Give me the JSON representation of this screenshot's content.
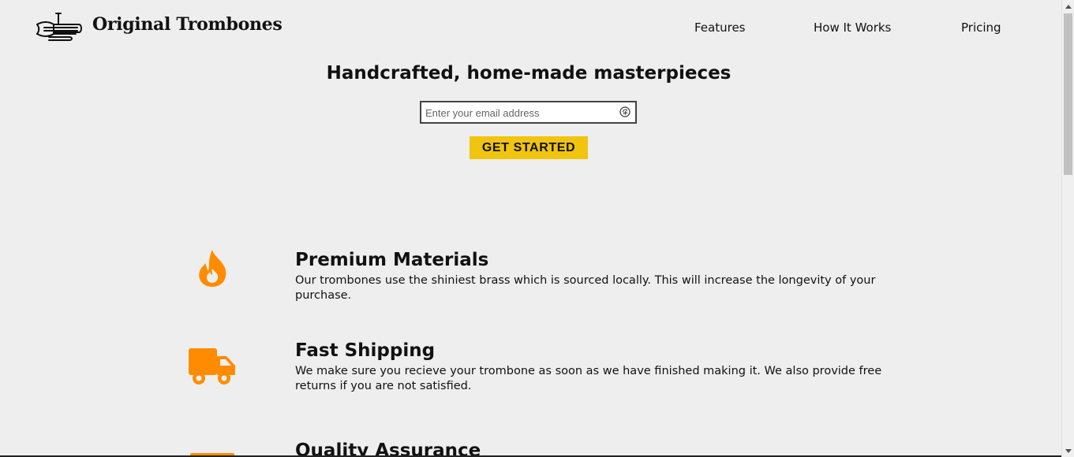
{
  "header": {
    "brand": "Original Trombones",
    "logo_icon": "trombone-icon",
    "nav": [
      {
        "label": "Features"
      },
      {
        "label": "How It Works"
      },
      {
        "label": "Pricing"
      }
    ]
  },
  "hero": {
    "title": "Handcrafted, home-made masterpieces",
    "email_placeholder": "Enter your email address",
    "email_value": "",
    "cta_label": "GET STARTED"
  },
  "features": [
    {
      "icon": "fire-icon",
      "title": "Premium Materials",
      "text": "Our trombones use the shiniest brass which is sourced locally. This will increase the longevity of your purchase."
    },
    {
      "icon": "truck-icon",
      "title": "Fast Shipping",
      "text": "We make sure you recieve your trombone as soon as we have finished making it. We also provide free returns if you are not satisfied."
    },
    {
      "icon": "battery-icon",
      "title": "Quality Assurance",
      "text": ""
    }
  ],
  "colors": {
    "background": "#eeeeee",
    "accent": "#f1c40f",
    "icon": "#ff8c00"
  }
}
